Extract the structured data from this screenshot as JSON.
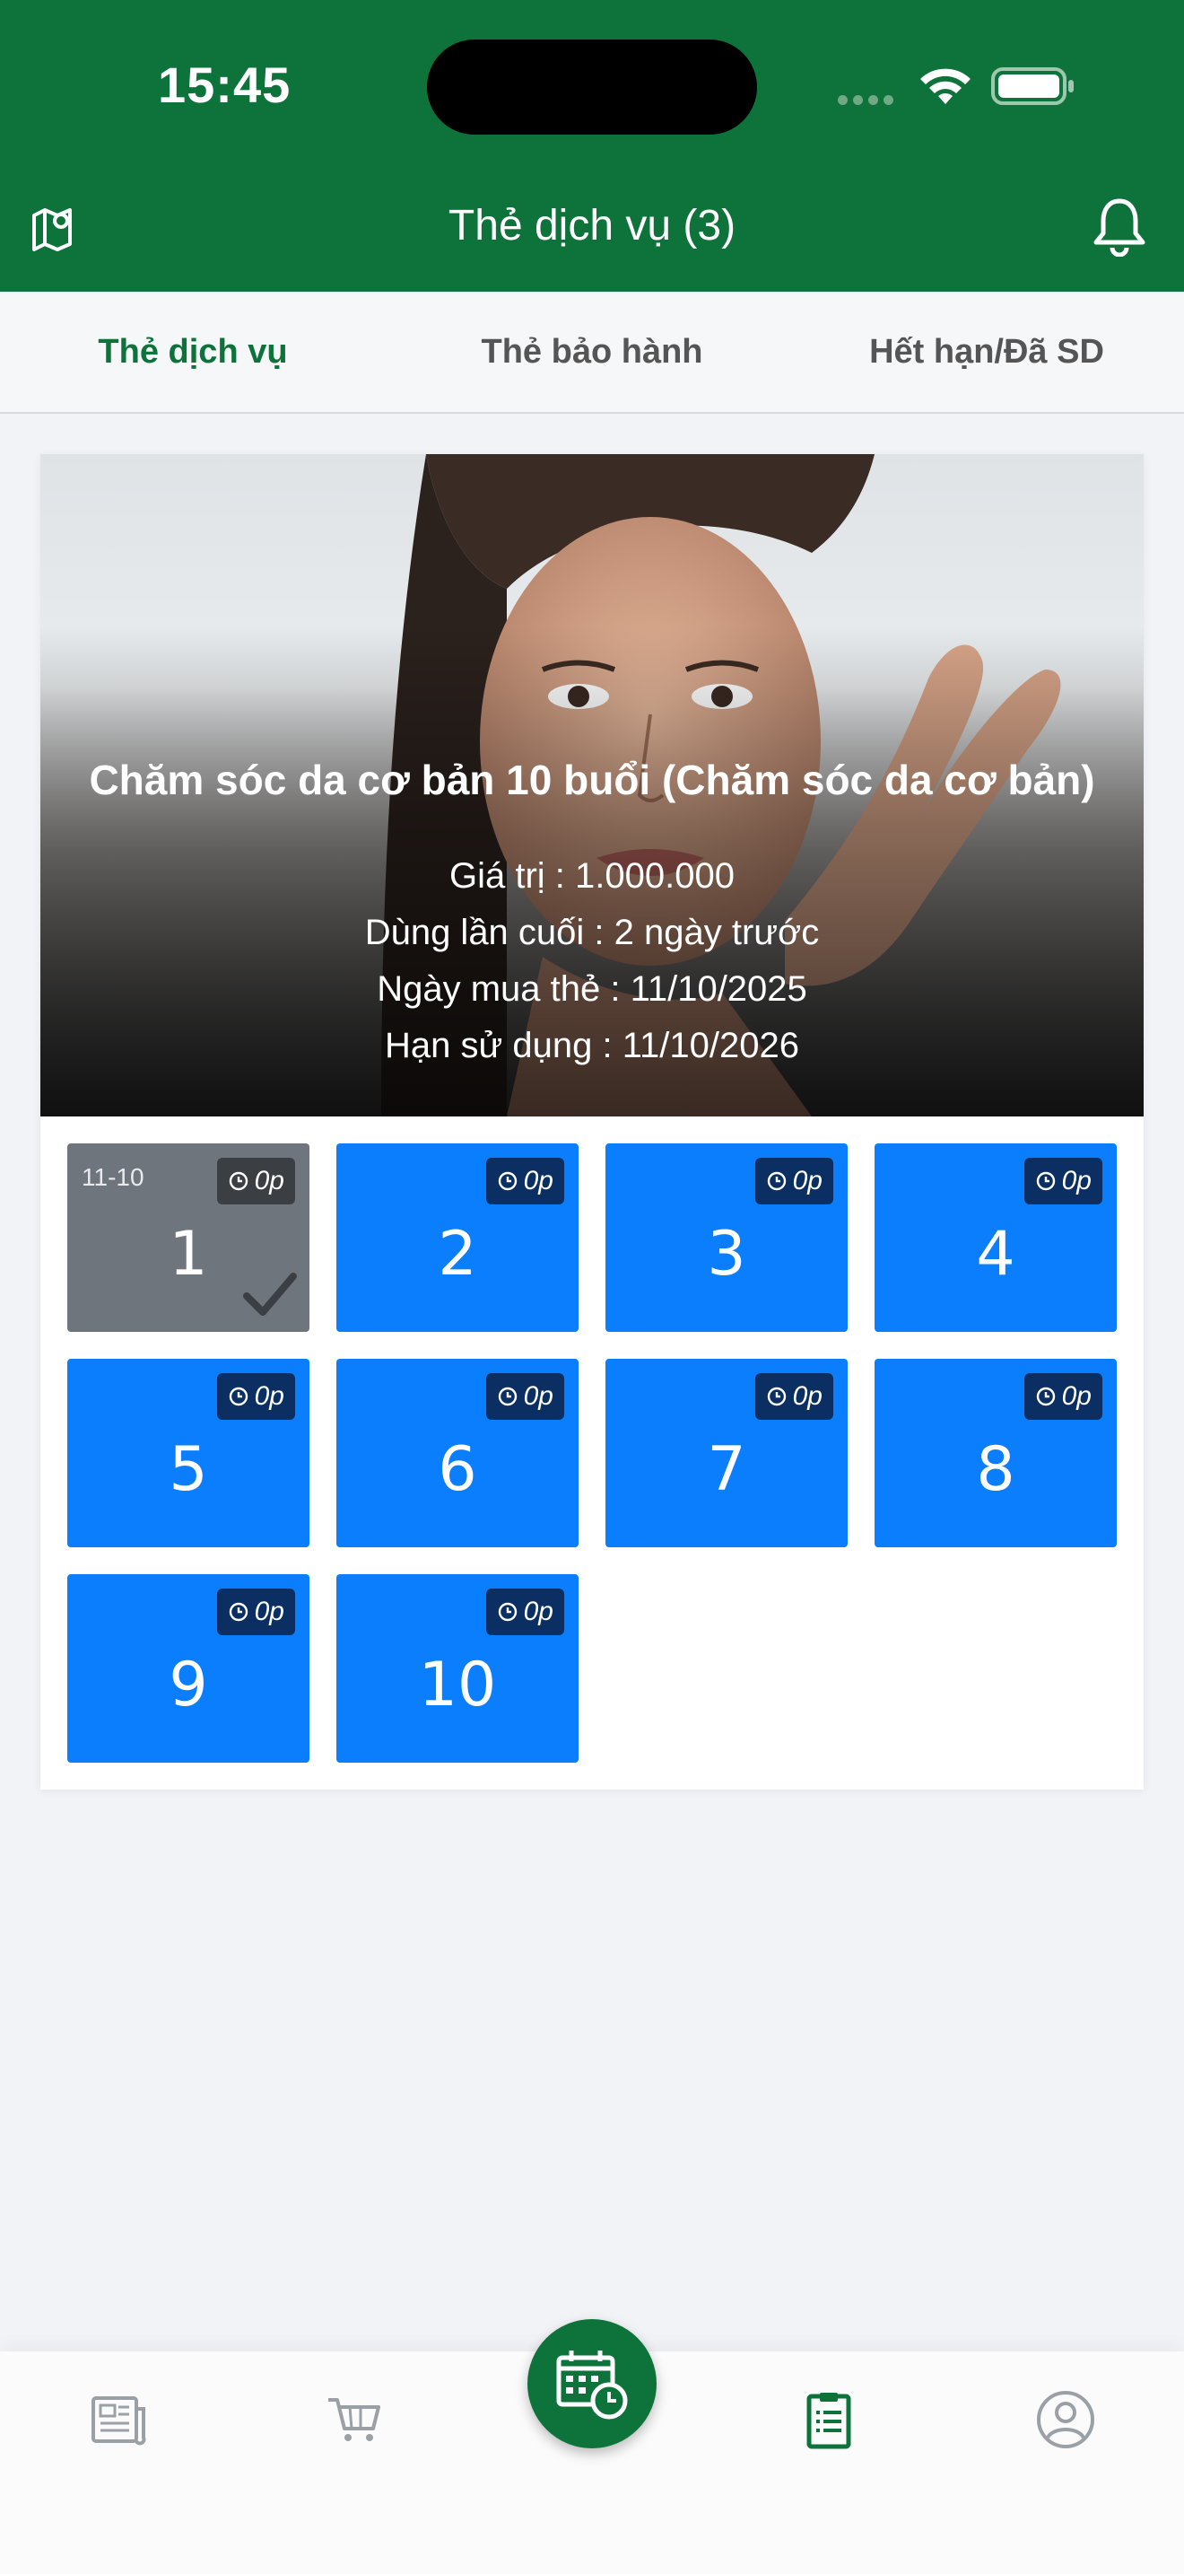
{
  "status_bar": {
    "time": "15:45"
  },
  "header": {
    "title": "Thẻ dịch vụ (3)"
  },
  "tabs": [
    {
      "label": "Thẻ dịch vụ",
      "active": true
    },
    {
      "label": "Thẻ bảo hành",
      "active": false
    },
    {
      "label": "Hết hạn/Đã SD",
      "active": false
    }
  ],
  "card": {
    "title": "Chăm sóc da cơ bản 10 buổi (Chăm sóc da cơ bản)",
    "value_line": "Giá trị : 1.000.000",
    "last_used_line": "Dùng lần cuối : 2 ngày trước",
    "purchase_line": "Ngày mua thẻ : 11/10/2025",
    "expiry_line": "Hạn sử dụng : 11/10/2026"
  },
  "sessions": [
    {
      "number": "1",
      "duration": "0p",
      "date": "11-10",
      "used": true
    },
    {
      "number": "2",
      "duration": "0p",
      "date": "",
      "used": false
    },
    {
      "number": "3",
      "duration": "0p",
      "date": "",
      "used": false
    },
    {
      "number": "4",
      "duration": "0p",
      "date": "",
      "used": false
    },
    {
      "number": "5",
      "duration": "0p",
      "date": "",
      "used": false
    },
    {
      "number": "6",
      "duration": "0p",
      "date": "",
      "used": false
    },
    {
      "number": "7",
      "duration": "0p",
      "date": "",
      "used": false
    },
    {
      "number": "8",
      "duration": "0p",
      "date": "",
      "used": false
    },
    {
      "number": "9",
      "duration": "0p",
      "date": "",
      "used": false
    },
    {
      "number": "10",
      "duration": "0p",
      "date": "",
      "used": false
    }
  ],
  "bottom_nav": [
    {
      "icon": "news-icon",
      "active": false
    },
    {
      "icon": "cart-icon",
      "active": false
    },
    {
      "icon": "calendar-clock-icon",
      "active": false,
      "center": true
    },
    {
      "icon": "clipboard-list-icon",
      "active": true
    },
    {
      "icon": "user-circle-icon",
      "active": false
    }
  ],
  "colors": {
    "brand_green": "#0e733a",
    "session_blue": "#0a7efc",
    "session_used_gray": "#6f757d"
  }
}
